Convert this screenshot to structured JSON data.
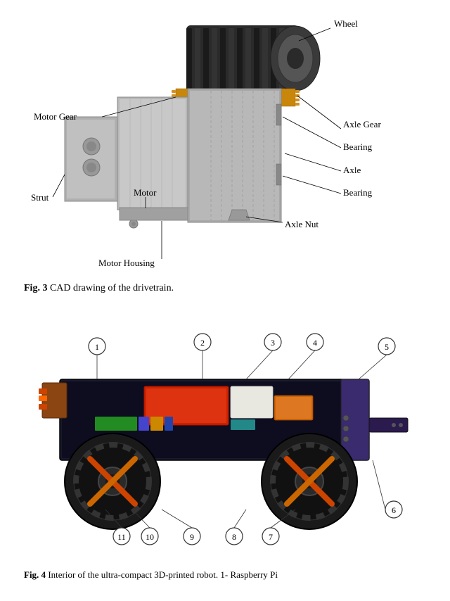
{
  "fig3": {
    "caption_bold": "Fig. 3",
    "caption_text": "  CAD drawing of the drivetrain.",
    "labels": {
      "wheel": "Wheel",
      "motor_gear": "Motor Gear",
      "axle_gear": "Axle Gear",
      "bearing_top": "Bearing",
      "axle": "Axle",
      "strut": "Strut",
      "motor": "Motor",
      "bearing_bottom": "Bearing",
      "motor_housing": "Motor Housing",
      "axle_nut": "Axle Nut"
    }
  },
  "fig4": {
    "caption_bold": "Fig. 4",
    "caption_text": "  Interior of the ultra-compact 3D-printed robot. 1- Raspberry Pi",
    "numbers": [
      "1",
      "2",
      "3",
      "4",
      "5",
      "6",
      "7",
      "8",
      "9",
      "10",
      "11"
    ]
  }
}
